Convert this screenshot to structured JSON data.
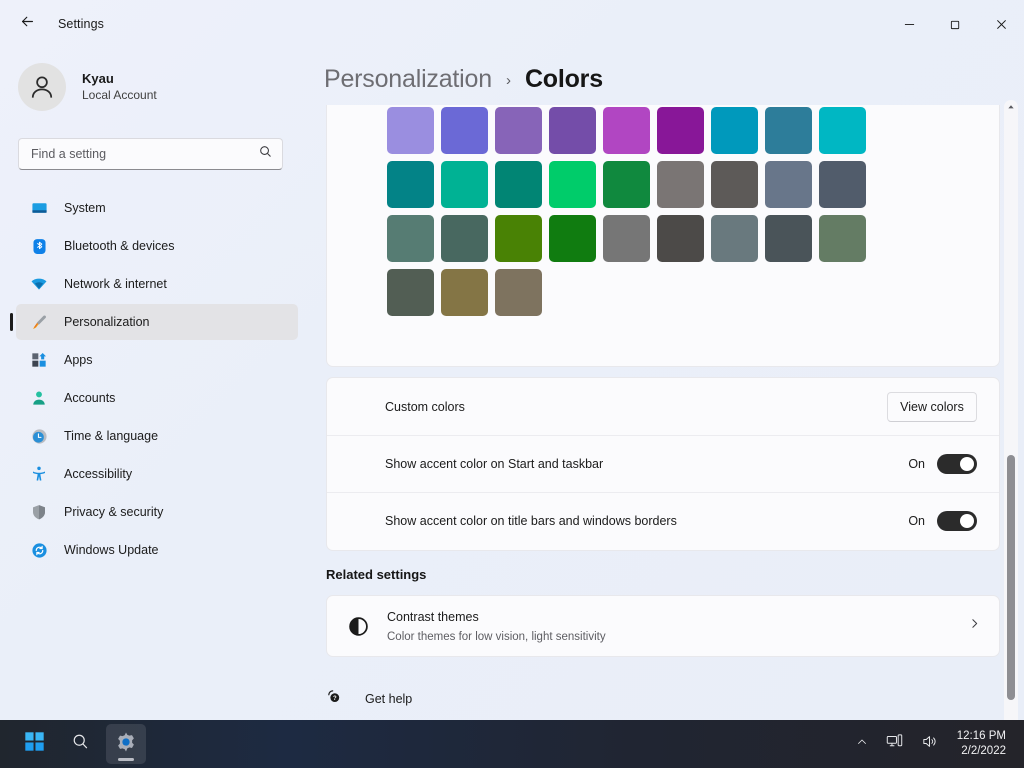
{
  "window": {
    "title": "Settings",
    "back_icon": "back-arrow-icon",
    "minimize_label": "Minimize",
    "maximize_label": "Maximize",
    "close_label": "Close"
  },
  "sidebar": {
    "profile": {
      "name": "Kyau",
      "account_type": "Local Account"
    },
    "search": {
      "placeholder": "Find a setting",
      "value": "",
      "icon": "search-icon"
    },
    "items": [
      {
        "label": "System",
        "icon": "monitor-icon",
        "active": false
      },
      {
        "label": "Bluetooth & devices",
        "icon": "bluetooth-icon",
        "active": false
      },
      {
        "label": "Network & internet",
        "icon": "wifi-icon",
        "active": false
      },
      {
        "label": "Personalization",
        "icon": "paintbrush-icon",
        "active": true
      },
      {
        "label": "Apps",
        "icon": "apps-icon",
        "active": false
      },
      {
        "label": "Accounts",
        "icon": "person-icon",
        "active": false
      },
      {
        "label": "Time & language",
        "icon": "clock-icon",
        "active": false
      },
      {
        "label": "Accessibility",
        "icon": "accessibility-icon",
        "active": false
      },
      {
        "label": "Privacy & security",
        "icon": "shield-icon",
        "active": false
      },
      {
        "label": "Windows Update",
        "icon": "update-icon",
        "active": false
      }
    ]
  },
  "breadcrumb": {
    "parent": "Personalization",
    "separator": "›",
    "current": "Colors"
  },
  "accent_colors": {
    "note": "Windows accent color swatch grid, top row clipped by scroll",
    "swatches": [
      "#9a8ee0",
      "#6b69d6",
      "#8764b8",
      "#744da9",
      "#b146c2",
      "#881798",
      "#0099bc",
      "#2d7d9a",
      "#00b7c3",
      "#038387",
      "#00b294",
      "#018574",
      "#00cc6a",
      "#10893e",
      "#7a7574",
      "#5d5a58",
      "#68768a",
      "#515c6b",
      "#567c73",
      "#486860",
      "#498205",
      "#107c10",
      "#767676",
      "#4c4a48",
      "#69797e",
      "#4a5459",
      "#647c64",
      "#525e54",
      "#847545",
      "#7e735f"
    ]
  },
  "settings_rows": [
    {
      "label": "Custom colors",
      "control": "button",
      "button_label": "View colors"
    },
    {
      "label": "Show accent color on Start and taskbar",
      "control": "toggle",
      "state": "On"
    },
    {
      "label": "Show accent color on title bars and windows borders",
      "control": "toggle",
      "state": "On"
    }
  ],
  "related": {
    "heading": "Related settings",
    "items": [
      {
        "title": "Contrast themes",
        "subtitle": "Color themes for low vision, light sensitivity",
        "icon": "contrast-icon",
        "chevron": "chevron-right-icon"
      }
    ]
  },
  "get_help": {
    "label": "Get help",
    "icon": "help-icon"
  },
  "highlight": {
    "color": "#ef27d8",
    "description": "magenta annotation box around the controls column"
  },
  "scrollbar": {
    "up_icon": "chevron-up-icon",
    "down_icon": "chevron-down-icon",
    "thumb_color": "#8e8e93"
  },
  "taskbar": {
    "start_label": "Start",
    "search_label": "Search",
    "settings_label": "Settings",
    "tray": {
      "overflow_icon": "chevron-up-icon",
      "network_icon": "network-icon",
      "volume_icon": "speaker-icon"
    },
    "clock": {
      "time": "12:16 PM",
      "date": "2/2/2022"
    }
  }
}
